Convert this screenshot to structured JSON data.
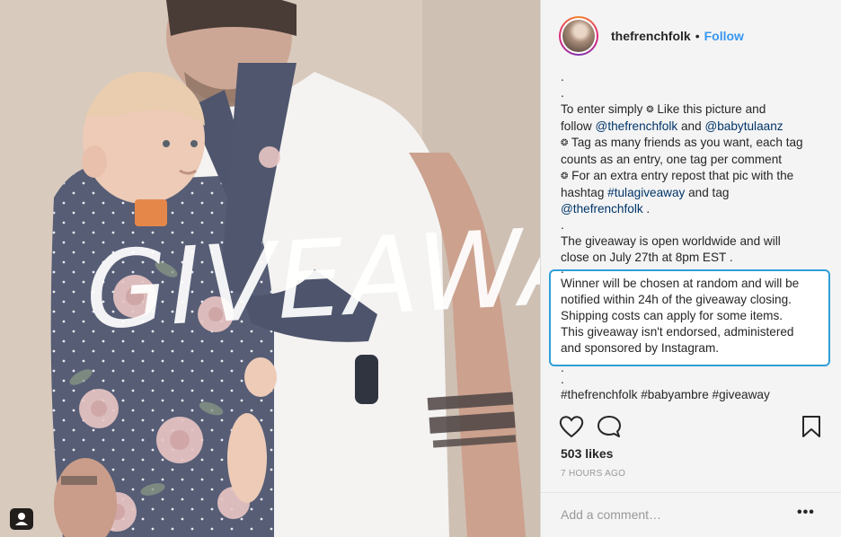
{
  "post": {
    "username": "thefrenchfolk",
    "separator": "•",
    "follow_label": "Follow",
    "overlay_text": "GIVEAWAY"
  },
  "caption": {
    "dot1": ".",
    "dot2": ".",
    "l1": "To enter simply",
    "l1b": "Like this picture and",
    "l2a": "follow",
    "l2_link1": "@thefrenchfolk",
    "l2b": "and",
    "l2_link2": "@babytulaanz",
    "l3": "Tag as many friends as you want, each tag",
    "l4": "counts as an entry, one tag per comment",
    "l5": "For an extra entry repost that pic with the",
    "l6a": "hashtag",
    "l6_link": "#tulagiveaway",
    "l6b": "and tag",
    "l7_link": "@thefrenchfolk",
    "l7b": ".",
    "dot3": ".",
    "l8": "The giveaway  is open worldwide and will",
    "l9": "close on July 27th at 8pm EST .",
    "dot4": ".",
    "bullet": "❂"
  },
  "highlight": {
    "h1": "Winner will be chosen at random and will be",
    "h2": "notified within 24h of the giveaway closing.",
    "h3": "Shipping costs can apply for some items.",
    "h4": "This giveaway isn't endorsed, administered",
    "h5": "and sponsored by Instagram.",
    "dot5": ".",
    "dot6": "."
  },
  "hashtags": {
    "tag1": "#thefrenchfolk",
    "tag2": "#babyambre",
    "tag3": "#giveaway"
  },
  "stats": {
    "likes": "503 likes",
    "time": "7 HOURS AGO"
  },
  "comment": {
    "placeholder": "Add a comment…",
    "more": "•••"
  },
  "icons": {
    "like": "heart-icon",
    "comment": "speech-bubble-icon",
    "save": "bookmark-icon",
    "tagged_user": "user-tag-icon"
  },
  "colors": {
    "link": "#003569",
    "follow": "#3897f0",
    "highlight_border": "#2f9fd8",
    "sidebar_bg": "#f4f4f4"
  }
}
